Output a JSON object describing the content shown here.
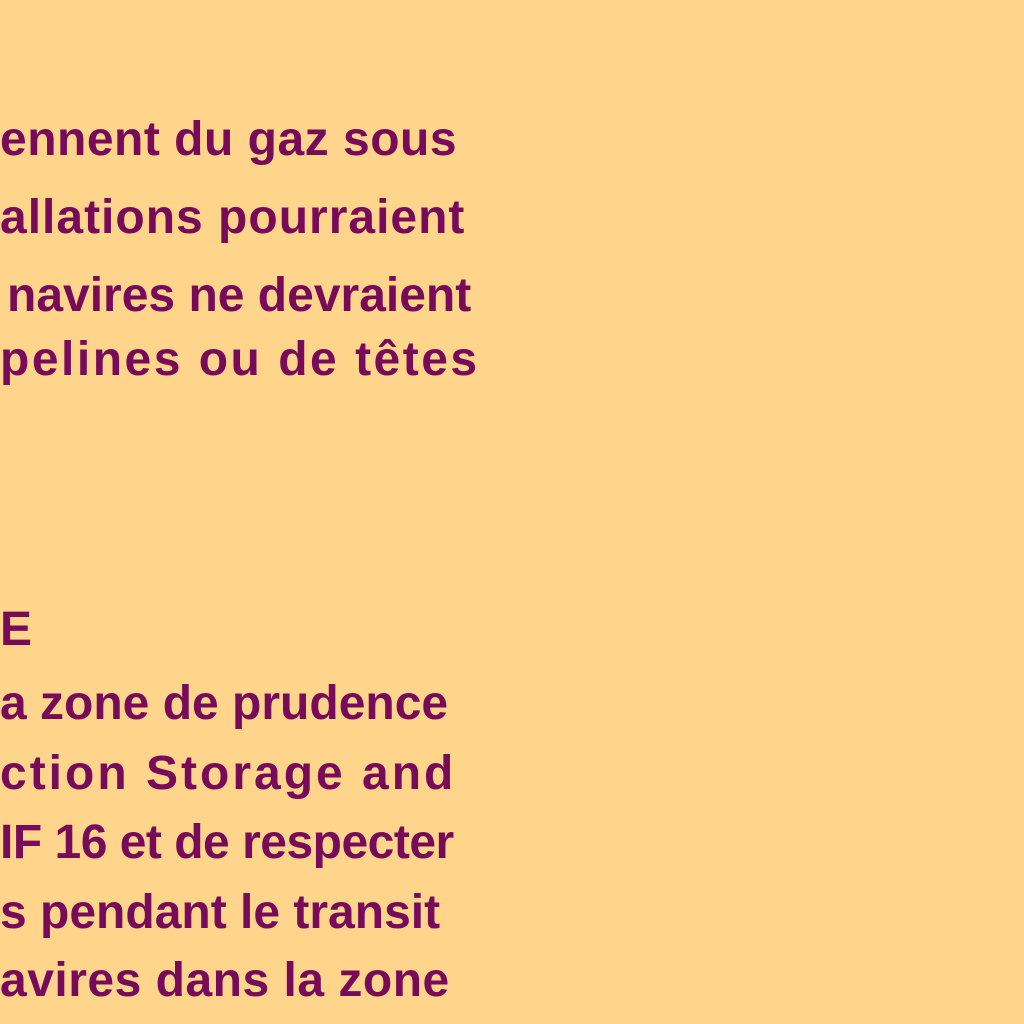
{
  "colors": {
    "background": "#ffd48b",
    "text": "#770b5a"
  },
  "paragraph_1": {
    "lines": [
      "ennent du gaz sous",
      "allations pourraient",
      "navires ne devraient",
      "pelines ou de têtes"
    ]
  },
  "section_heading": "E",
  "paragraph_2": {
    "lines": [
      "a zone de prudence",
      "ction Storage and",
      "IF 16 et de respecter",
      "s pendant le transit",
      "avires dans la zone"
    ]
  }
}
